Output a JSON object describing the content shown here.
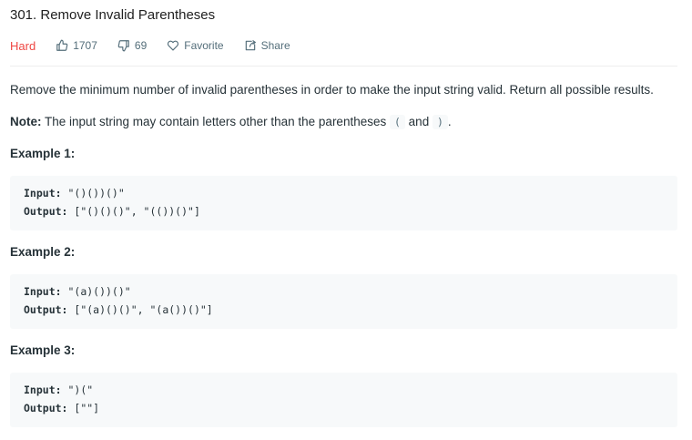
{
  "problem": {
    "title": "301. Remove Invalid Parentheses",
    "difficulty": "Hard",
    "likes": "1707",
    "dislikes": "69",
    "favorite_label": "Favorite",
    "share_label": "Share"
  },
  "colors": {
    "difficulty_hard": "#ef4743",
    "meta_text": "#546e7a",
    "code_bg": "#f7f9fa",
    "text": "#263238"
  },
  "icons": {
    "like": "thumbs-up-icon",
    "dislike": "thumbs-down-icon",
    "favorite": "heart-icon",
    "share": "share-icon"
  },
  "description": {
    "text": "Remove the minimum number of invalid parentheses in order to make the input string valid. Return all possible results.",
    "note_label": "Note:",
    "note_text": " The input string may contain letters other than the parentheses ",
    "paren_open": "(",
    "and_text": " and ",
    "paren_close": ")",
    "period": "."
  },
  "examples": [
    {
      "heading": "Example 1:",
      "input_label": "Input:",
      "input_value": " \"()())()\"",
      "output_label": "Output:",
      "output_value": " [\"()()()\", \"(())()\"]"
    },
    {
      "heading": "Example 2:",
      "input_label": "Input:",
      "input_value": " \"(a)())()\"",
      "output_label": "Output:",
      "output_value": " [\"(a)()()\", \"(a())()\"]"
    },
    {
      "heading": "Example 3:",
      "input_label": "Input:",
      "input_value": " \")(\"",
      "output_label": "Output:",
      "output_value": " [\"\"]"
    }
  ]
}
